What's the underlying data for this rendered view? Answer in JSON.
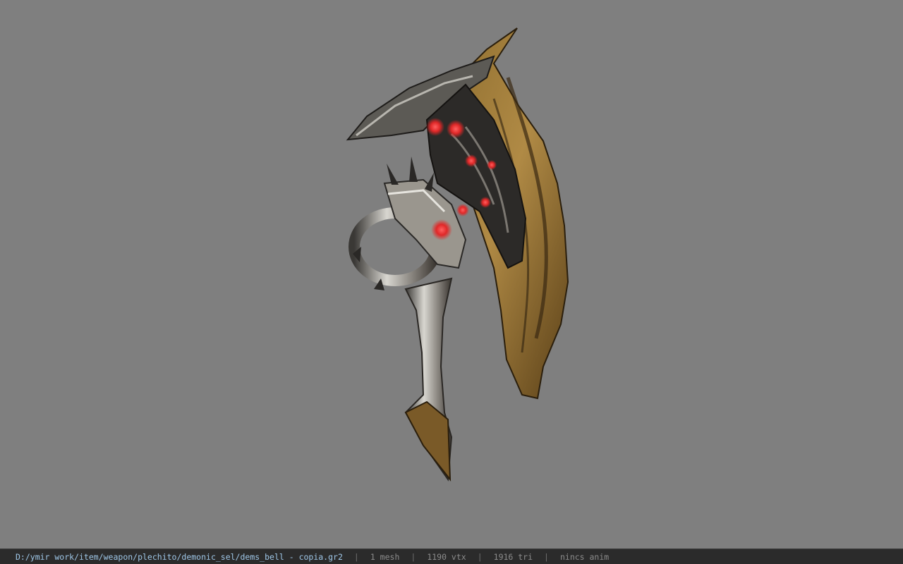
{
  "viewport": {
    "background": "#7f7f7f",
    "model_name": "demonic axe weapon model"
  },
  "statusbar": {
    "file_path": "D:/ymir work/item/weapon/plechito/demonic_sel/dems_bell - copia.gr2",
    "separator": "|",
    "mesh_count": "1 mesh",
    "vertex_count": "1190 vtx",
    "triangle_count": "1916 tri",
    "anim_status": "nincs anim"
  }
}
